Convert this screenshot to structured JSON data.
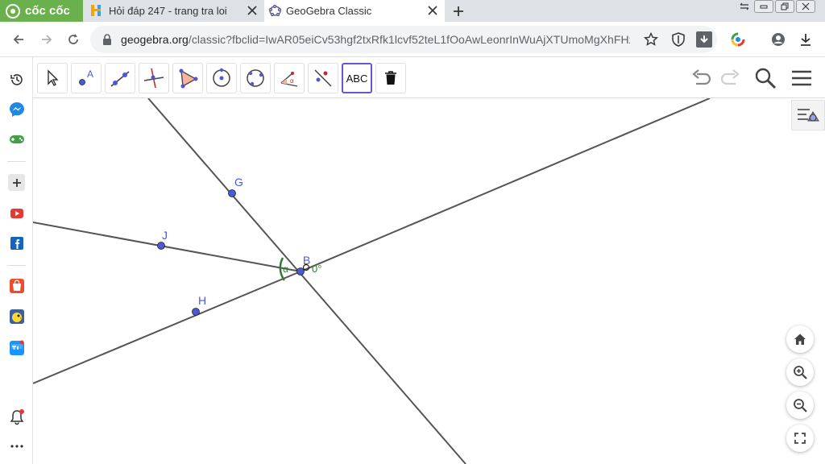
{
  "browser": {
    "brand": "cốc cốc",
    "tabs": [
      {
        "title": "Hỏi đáp 247 - trang tra loi",
        "active": false
      },
      {
        "title": "GeoGebra Classic",
        "active": true
      }
    ],
    "url_host": "geogebra.org",
    "url_rest": "/classic?fbclid=IwAR05eiCv53hgf2txRfk1lcvf52teL1fOoAwLeonrInWuAjXTUmoMgXhFHzc#geo..."
  },
  "toolbar": {
    "text_tool_label": "ABC"
  },
  "colors": {
    "point": "#4a5ad6",
    "line": "#555555",
    "angle": "#2e7d32",
    "active_tool_border": "#6557d2",
    "brand_green": "#6ab04c"
  },
  "construction": {
    "points": [
      {
        "name": "G",
        "label": "G"
      },
      {
        "name": "J",
        "label": "J"
      },
      {
        "name": "H",
        "label": "H"
      },
      {
        "name": "B",
        "label": "B"
      }
    ],
    "angle": {
      "name": "α",
      "label": "α",
      "value_text": "0°"
    }
  }
}
